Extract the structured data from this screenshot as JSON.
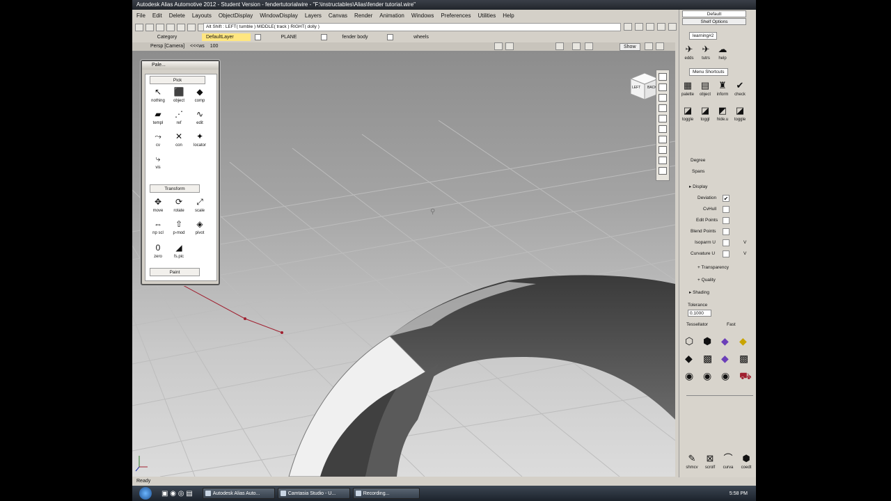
{
  "window": {
    "title": "Autodesk Alias Automotive 2012 - Student Version - fendertutorialwire - \"F:\\instructables\\Alias\\fender tutorial.wire\""
  },
  "menu": [
    "File",
    "Edit",
    "Delete",
    "Layouts",
    "ObjectDisplay",
    "WindowDisplay",
    "Layers",
    "Canvas",
    "Render",
    "Animation",
    "Windows",
    "Preferences",
    "Utilities",
    "Help"
  ],
  "toolbar": {
    "hint": "Alt Shift :   LEFT( tumble )   MIDDLE( track )   RIGHT( dolly )"
  },
  "layers": {
    "category_label": "Category",
    "items": [
      "DefaultLayer",
      "PLANE",
      "fender body",
      "wheels"
    ]
  },
  "viewport": {
    "label": "Persp [Camera]",
    "mode": "<<<ws",
    "zoom": "100",
    "show_button": "Show",
    "viewcube_left": "LEFT",
    "viewcube_back": "BACK"
  },
  "palette": {
    "title": "Pale...",
    "pick_section": "Pick",
    "pick_tools": [
      {
        "label": "nothing",
        "icon": "arrow-icon"
      },
      {
        "label": "object",
        "icon": "object-pick-icon"
      },
      {
        "label": "comp",
        "icon": "component-pick-icon"
      },
      {
        "label": "templ",
        "icon": "template-pick-icon"
      },
      {
        "label": "ref",
        "icon": "reference-pick-icon"
      },
      {
        "label": "edit",
        "icon": "edit-pick-icon"
      },
      {
        "label": "cv",
        "icon": "cv-pick-icon"
      },
      {
        "label": "con",
        "icon": "construction-pick-icon"
      },
      {
        "label": "locator",
        "icon": "locator-pick-icon"
      },
      {
        "label": "vis",
        "icon": "visible-pick-icon"
      }
    ],
    "transform_section": "Transform",
    "transform_tools": [
      {
        "label": "move",
        "icon": "move-icon"
      },
      {
        "label": "rotate",
        "icon": "rotate-icon"
      },
      {
        "label": "scale",
        "icon": "scale-icon"
      },
      {
        "label": "np scl",
        "icon": "nonproportional-scale-icon"
      },
      {
        "label": "p-mod",
        "icon": "proportional-modify-icon"
      },
      {
        "label": "pivot",
        "icon": "pivot-icon"
      },
      {
        "label": "zero",
        "icon": "zero-transform-icon"
      },
      {
        "label": "fs.pic",
        "icon": "freeze-icon"
      }
    ],
    "paint_tab": "Paint"
  },
  "shelf": {
    "default_select": "Default",
    "shelf_options": "Shelf Options",
    "tab1": "learning#2",
    "tab1_items": [
      {
        "label": "edds",
        "icon": "edds-icon"
      },
      {
        "label": "tutrs",
        "icon": "tutorials-icon"
      },
      {
        "label": "help",
        "icon": "help-icon"
      }
    ],
    "tab2": "Menu Shortcuts",
    "tab2_items": [
      {
        "label": "palette",
        "icon": "palette-icon"
      },
      {
        "label": "object",
        "icon": "object-icon"
      },
      {
        "label": "inform",
        "icon": "inform-icon"
      },
      {
        "label": "check",
        "icon": "check-icon"
      },
      {
        "label": "toggle",
        "icon": "toggle-icon"
      },
      {
        "label": "toggl",
        "icon": "toggle2-icon"
      },
      {
        "label": "hide.u",
        "icon": "hide-unselected-icon"
      },
      {
        "label": "toggle",
        "icon": "toggle3-icon"
      }
    ]
  },
  "attributes": {
    "degree_label": "Degree",
    "spans_label": "Spans",
    "display_section": "Display",
    "rows": [
      {
        "label": "Deviation",
        "checked": true
      },
      {
        "label": "CvHull",
        "checked": false
      },
      {
        "label": "Edit Points",
        "checked": false
      },
      {
        "label": "Blend Points",
        "checked": false
      },
      {
        "label": "Isoparm U",
        "checked": false
      },
      {
        "label": "Curvature U",
        "checked": false
      }
    ],
    "v_label": "V",
    "transparency": "Transparency",
    "quality": "Quality",
    "shading_section": "Shading",
    "tolerance_label": "Tolerance",
    "tolerance_value": "0.1000",
    "tessellator_label": "Tessellator",
    "tessellator_value": "Fast",
    "bottom_tools": [
      {
        "label": "shmcv",
        "icon": "shader-icon"
      },
      {
        "label": "scrolf",
        "icon": "scroll-icon"
      },
      {
        "label": "curva",
        "icon": "curvature-icon"
      },
      {
        "label": "coedt",
        "icon": "coedit-icon"
      }
    ]
  },
  "status": {
    "text": "Ready"
  },
  "taskbar": {
    "items": [
      "Autodesk Alias Auto...",
      "Camtasia Studio - U...",
      "Recording..."
    ],
    "clock": "5:58 PM"
  },
  "colors": {
    "accent_yellow": "#ffe680",
    "curve_red": "#a02030"
  }
}
